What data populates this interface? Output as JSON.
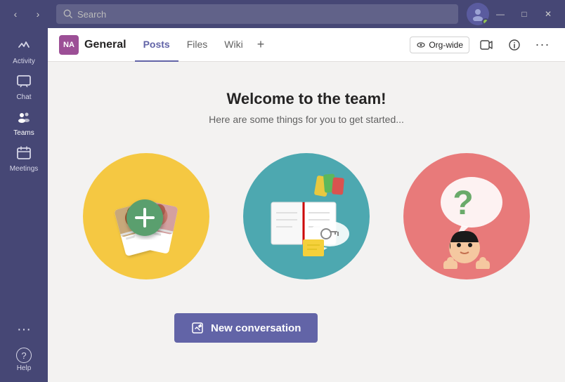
{
  "titlebar": {
    "search_placeholder": "Search",
    "nav_back": "‹",
    "nav_forward": "›",
    "minimize": "—",
    "maximize": "□",
    "close": "✕"
  },
  "sidebar": {
    "items": [
      {
        "id": "activity",
        "label": "Activity",
        "icon": "🔔"
      },
      {
        "id": "chat",
        "label": "Chat",
        "icon": "💬"
      },
      {
        "id": "teams",
        "label": "Teams",
        "icon": "👥",
        "active": true
      },
      {
        "id": "meetings",
        "label": "Meetings",
        "icon": "📅"
      }
    ],
    "more_label": "···",
    "help_label": "Help",
    "help_icon": "?"
  },
  "channel": {
    "avatar": "NA",
    "name": "General",
    "tabs": [
      {
        "id": "posts",
        "label": "Posts",
        "active": true
      },
      {
        "id": "files",
        "label": "Files",
        "active": false
      },
      {
        "id": "wiki",
        "label": "Wiki",
        "active": false
      }
    ],
    "add_tab_icon": "+",
    "org_wide_label": "Org-wide",
    "actions": {
      "video": "📹",
      "info": "ℹ",
      "more": "···"
    }
  },
  "main": {
    "welcome_title": "Welcome to the team!",
    "welcome_subtitle": "Here are some things for you to get started...",
    "new_conversation_label": "New conversation",
    "illustrations": [
      {
        "id": "people",
        "color": "#f5c842"
      },
      {
        "id": "book",
        "color": "#4da8b0"
      },
      {
        "id": "question",
        "color": "#e87a7a"
      }
    ]
  }
}
